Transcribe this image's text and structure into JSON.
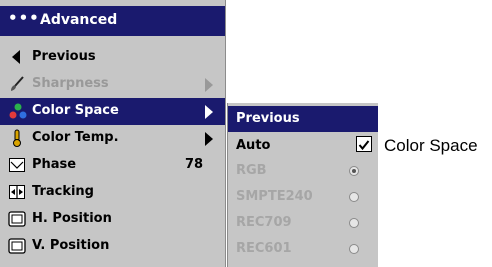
{
  "menu": {
    "title": "Advanced",
    "items": [
      {
        "label": "Previous",
        "icon": "left-arrow-icon"
      },
      {
        "label": "Sharpness",
        "icon": "brush-icon",
        "disabled": true
      },
      {
        "label": "Color Space",
        "icon": "color-dots-icon",
        "selected": true
      },
      {
        "label": "Color Temp.",
        "icon": "thermometer-icon"
      },
      {
        "label": "Phase",
        "icon": "phase-icon",
        "value": "78"
      },
      {
        "label": "Tracking",
        "icon": "tracking-icon"
      },
      {
        "label": "H. Position",
        "icon": "monitor-icon"
      },
      {
        "label": "V. Position",
        "icon": "monitor-icon"
      }
    ]
  },
  "submenu": {
    "items": [
      {
        "label": "Previous",
        "selected": true
      },
      {
        "label": "Auto",
        "checkbox": true
      },
      {
        "label": "RGB",
        "disabled": true,
        "radio": "checked"
      },
      {
        "label": "SMPTE240",
        "disabled": true,
        "radio": "unchecked"
      },
      {
        "label": "REC709",
        "disabled": true,
        "radio": "unchecked"
      },
      {
        "label": "REC601",
        "disabled": true,
        "radio": "unchecked"
      }
    ]
  },
  "callout_label": "Color Space",
  "colors": {
    "menu_bg": "#c6c6c6",
    "accent": "#1a1a6e",
    "disabled": "#999999"
  }
}
